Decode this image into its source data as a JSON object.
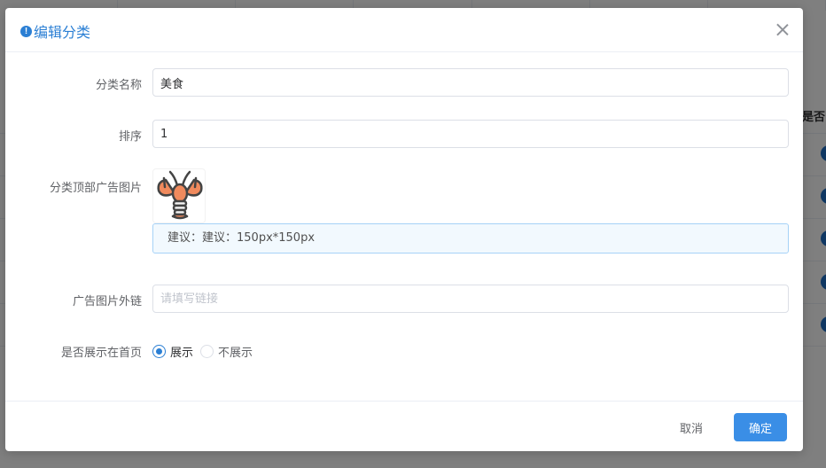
{
  "background": {
    "column_header": "是否"
  },
  "dialog": {
    "title": "编辑分类",
    "fields": {
      "name": {
        "label": "分类名称",
        "value": "美食"
      },
      "sort": {
        "label": "排序",
        "value": "1"
      },
      "ad_image": {
        "label": "分类顶部广告图片",
        "tip": "建议：建议：150px*150px"
      },
      "ad_link": {
        "label": "广告图片外链",
        "value": "",
        "placeholder": "请填写链接"
      },
      "show_home": {
        "label": "是否展示在首页",
        "options": [
          "展示",
          "不展示"
        ],
        "selected": "展示"
      }
    },
    "footer": {
      "cancel_label": "取消",
      "confirm_label": "确定"
    }
  },
  "colors": {
    "accent": "#2b7fd4",
    "primary_button": "#3a8ee6",
    "tip_background": "#f2f9fe",
    "tip_border": "#a6d2f7",
    "mask": "rgba(0,0,0,0.5)"
  },
  "icons": {
    "title_icon": "info-icon",
    "close": "close-icon",
    "uploaded_image": "lobster-icon"
  }
}
